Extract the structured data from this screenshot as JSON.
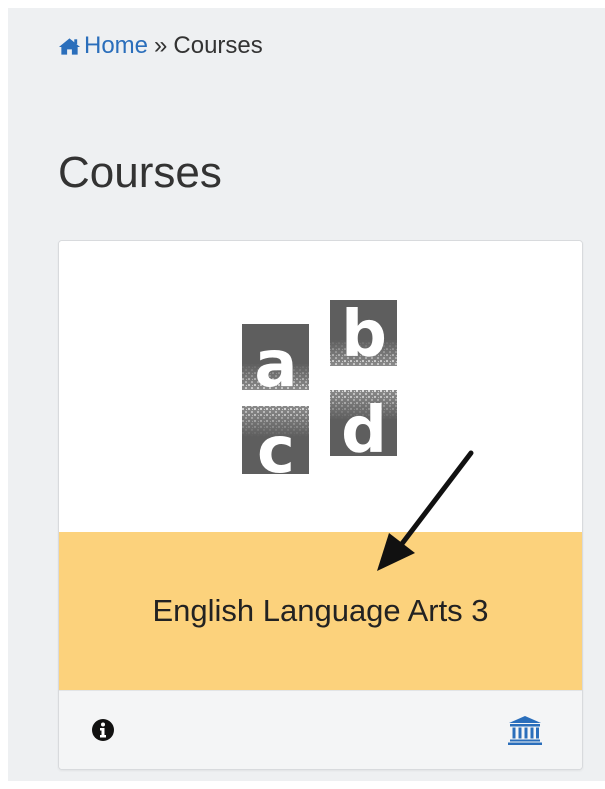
{
  "breadcrumb": {
    "home_icon": "home-icon",
    "home_label": "Home",
    "separator": "»",
    "current": "Courses"
  },
  "page": {
    "title": "Courses"
  },
  "course_card": {
    "logo_letters": [
      "a",
      "b",
      "c",
      "d"
    ],
    "title": "English Language Arts 3",
    "band_color": "#fcd27c",
    "footer_icons": [
      "info-icon",
      "bank-icon"
    ]
  },
  "colors": {
    "link": "#2a6ebb",
    "background": "#eef0f2",
    "arrow": "#111111"
  }
}
